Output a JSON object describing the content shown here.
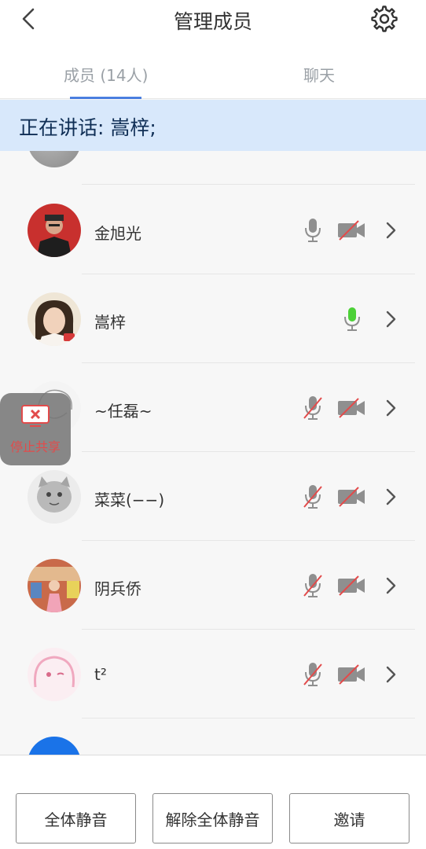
{
  "header": {
    "title": "管理成员"
  },
  "tabs": {
    "members": "成员 (14人)",
    "chat": "聊天"
  },
  "speaking": {
    "text": "正在讲话: 嵩梓;"
  },
  "members": [
    {
      "name": "",
      "mic": "muted",
      "camera": "off"
    },
    {
      "name": "金旭光",
      "mic": "on-gray",
      "camera": "off"
    },
    {
      "name": "嵩梓",
      "mic": "speaking",
      "camera": "none"
    },
    {
      "name": "~任磊~",
      "mic": "muted",
      "camera": "off"
    },
    {
      "name": "菜菜(−−)",
      "mic": "muted",
      "camera": "off"
    },
    {
      "name": "阴兵侨",
      "mic": "muted",
      "camera": "off"
    },
    {
      "name": "t²",
      "mic": "muted",
      "camera": "off"
    },
    {
      "name": "",
      "mic": "muted",
      "camera": "off"
    }
  ],
  "stop_share": {
    "label": "停止共享"
  },
  "footer": {
    "mute_all": "全体静音",
    "unmute_all": "解除全体静音",
    "invite": "邀请"
  },
  "colors": {
    "accent": "#4a7fe0",
    "speaking_bar": "#d8e8fb",
    "mic_active": "#4cd137",
    "muted_slash": "#e24b4b"
  }
}
